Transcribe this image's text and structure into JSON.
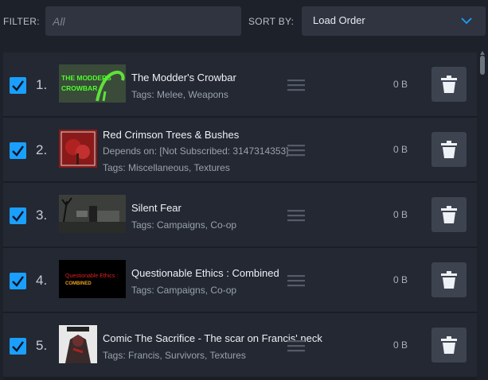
{
  "filter": {
    "label": "FILTER:",
    "placeholder": "All",
    "value": ""
  },
  "sort": {
    "label": "SORT BY:",
    "value": "Load Order"
  },
  "icons": {
    "checkbox": "check-icon",
    "drag": "drag-handle-icon",
    "delete": "trash-icon",
    "dropdown": "chevron-down-icon"
  },
  "colors": {
    "accent": "#1a9fff",
    "row_bg": "#232832",
    "button_bg": "#3d4450"
  },
  "items": [
    {
      "number": "1.",
      "title": "The Modder's Crowbar",
      "tags": "Tags: Melee, Weapons",
      "size": "0 B",
      "checked": true,
      "thumb_text": [
        "THE MODDERS",
        "CROWBAR"
      ]
    },
    {
      "number": "2.",
      "title": "Red Crimson Trees & Bushes",
      "depends": "Depends on: [Not Subscribed: 3147314353]",
      "tags": "Tags: Miscellaneous, Textures",
      "size": "0 B",
      "checked": true
    },
    {
      "number": "3.",
      "title": "Silent Fear",
      "tags": "Tags: Campaigns, Co-op",
      "size": "0 B",
      "checked": true
    },
    {
      "number": "4.",
      "title": "Questionable Ethics : Combined",
      "tags": "Tags: Campaigns, Co-op",
      "size": "0 B",
      "checked": true,
      "thumb_text": [
        "Questionable Ethics :",
        "COMBINED"
      ]
    },
    {
      "number": "5.",
      "title": "Comic The Sacrifice - The scar on Francis' neck",
      "tags": "Tags: Francis, Survivors, Textures",
      "size": "0 B",
      "checked": true
    }
  ]
}
